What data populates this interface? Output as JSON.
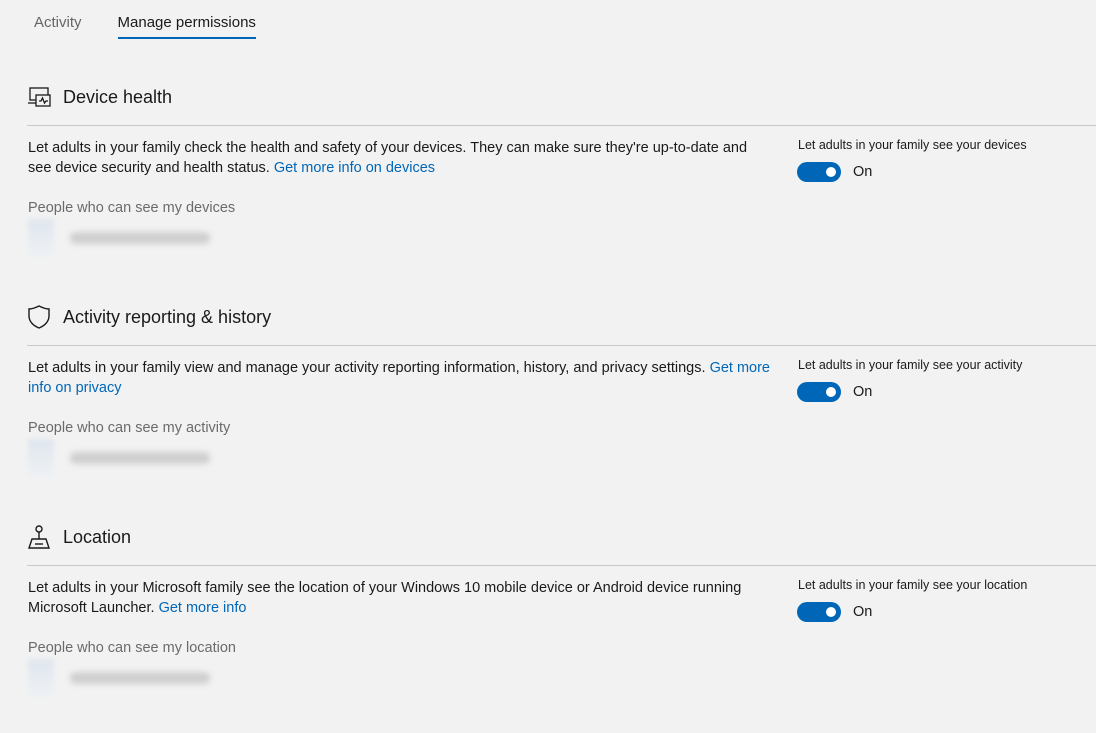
{
  "tabs": [
    {
      "label": "Activity",
      "active": false
    },
    {
      "label": "Manage permissions",
      "active": true
    }
  ],
  "accent_color": "#0067b8",
  "sections": [
    {
      "icon": "device-health-icon",
      "title": "Device health",
      "description": "Let adults in your family check the health and safety of your devices. They can make sure they're up-to-date and see device security and health status.",
      "link": "Get more info on devices",
      "people_label": "People who can see my devices",
      "toggle_label": "Let adults in your family see your devices",
      "toggle_state": "On"
    },
    {
      "icon": "shield-icon",
      "title": "Activity reporting & history",
      "description": "Let adults in your family view and manage your activity reporting information, history, and privacy settings.",
      "link": "Get more info on privacy",
      "people_label": "People who can see my activity",
      "toggle_label": "Let adults in your family see your activity",
      "toggle_state": "On"
    },
    {
      "icon": "location-icon",
      "title": "Location",
      "description": "Let adults in your Microsoft family see the location of your Windows 10 mobile device or Android device running Microsoft Launcher.",
      "link": "Get more info",
      "people_label": "People who can see my location",
      "toggle_label": "Let adults in your family see your location",
      "toggle_state": "On"
    }
  ]
}
